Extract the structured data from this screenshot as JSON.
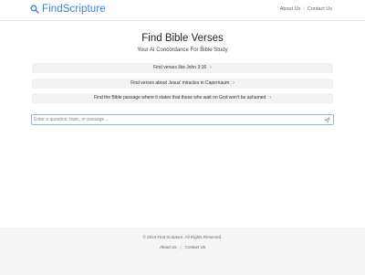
{
  "header": {
    "brand": "FindScripture",
    "nav": [
      {
        "label": "About Us"
      },
      {
        "label": "Contact Us"
      }
    ]
  },
  "hero": {
    "title": "Find Bible Verses",
    "subtitle": "Your AI Concordance For Bible Study"
  },
  "suggestions": [
    {
      "label": "Find verses like John 3:16"
    },
    {
      "label": "Find verses about Jesus' miracles in Capernaum"
    },
    {
      "label": "Find the Bible passage where it states that those who wait on God won't be ashamed"
    }
  ],
  "query": {
    "value": "",
    "placeholder": "Enter a question, topic, or passage..."
  },
  "footer": {
    "copyright": "© 2024 Find Scripture. All Rights Reserved.",
    "links": [
      {
        "label": "About Us"
      },
      {
        "label": "Contact Us"
      }
    ]
  },
  "colors": {
    "brand": "#3b7fd4",
    "input_border": "#8fb4e6",
    "suggestion_bg": "#f2f2f2",
    "footer_bg": "#f5f5f5"
  },
  "icons": {
    "brand": "search-icon",
    "suggestion": "chevron-right-icon",
    "submit": "send-icon"
  }
}
